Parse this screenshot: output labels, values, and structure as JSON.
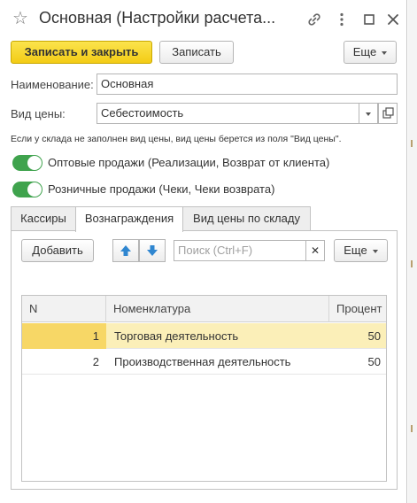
{
  "window": {
    "title": "Основная (Настройки расчета..."
  },
  "toolbar": {
    "save_close_label": "Записать и закрыть",
    "save_label": "Записать",
    "more_label": "Еще"
  },
  "form": {
    "name_label": "Наименование:",
    "name_value": "Основная",
    "price_type_label": "Вид цены:",
    "price_type_value": "Себестоимость",
    "note": "Если у склада не заполнен вид цены, вид цены берется из поля \"Вид цены\".",
    "wholesale_label": "Оптовые продажи (Реализации, Возврат от клиента)",
    "wholesale_on": true,
    "retail_label": "Розничные продажи (Чеки, Чеки возврата)",
    "retail_on": true
  },
  "tabs": [
    {
      "label": "Кассиры",
      "active": false
    },
    {
      "label": "Вознаграждения",
      "active": true
    },
    {
      "label": "Вид цены по складу",
      "active": false
    }
  ],
  "tab_toolbar": {
    "add_label": "Добавить",
    "search_placeholder": "Поиск (Ctrl+F)",
    "more_label": "Еще"
  },
  "table": {
    "columns": [
      "N",
      "Номенклатура",
      "Процент"
    ],
    "rows": [
      {
        "n": "1",
        "item": "Торговая деятельность",
        "percent": "50",
        "selected": true
      },
      {
        "n": "2",
        "item": "Производственная деятельность",
        "percent": "50",
        "selected": false
      }
    ]
  },
  "colors": {
    "primary_button": "#f5d31f",
    "toggle_on": "#3fa34d",
    "selected_row": "#fbefb8",
    "arrow_icon": "#2f86d0"
  }
}
